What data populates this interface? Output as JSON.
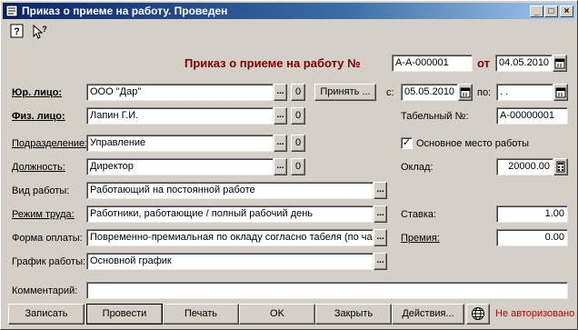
{
  "window": {
    "title": "Приказ о приеме на работу. Проведен",
    "controls": [
      "_",
      "□",
      "×"
    ]
  },
  "toolbar": {
    "help_icon": "?",
    "pointer_icon": "?"
  },
  "header": {
    "title": "Приказ о приеме на работу №",
    "number": "А-А-000001",
    "date_label": "от",
    "date": "04.05.2010"
  },
  "form": {
    "legal_entity": {
      "label": "Юр. лицо:",
      "value": "ООО \"Дар\""
    },
    "person": {
      "label": "Физ. лицо:",
      "value": "Лапин Г.И."
    },
    "department": {
      "label": "Подразделение:",
      "value": "Управление"
    },
    "position": {
      "label": "Должность:",
      "value": "Директор"
    },
    "work_type": {
      "label": "Вид работы:",
      "value": "Работающий на постоянной работе"
    },
    "labor_mode": {
      "label": "Режим труда:",
      "value": "Работники, работающие / полный рабочий день"
    },
    "pay_form": {
      "label": "Форма оплаты:",
      "value": "Повременно-премиальная по окладу согласно табеля (по ча"
    },
    "schedule": {
      "label": "График работы:",
      "value": "Основной график"
    },
    "comment": {
      "label": "Комментарий:",
      "value": ""
    },
    "zero_button": "0",
    "dots_button": "..."
  },
  "right": {
    "accept_button": "Принять ...",
    "from_label": "с:",
    "from_date": "05.05.2010",
    "to_label": "по:",
    "to_date": " .  .",
    "tab_label": "Табельный №:",
    "tab_number": "А-00000001",
    "main_job_label": "Основное место работы",
    "main_job_checked": "✓",
    "salary_label": "Оклад:",
    "salary": "20000.00",
    "rate_label": "Ставка:",
    "rate": "1.00",
    "bonus_label": "Премия:",
    "bonus": "0.00"
  },
  "buttons": {
    "write": "Записать",
    "post": "Провести",
    "print": "Печать",
    "ok": "OK",
    "close": "Закрыть",
    "actions": "Действия...",
    "status": "Не авторизовано"
  },
  "colors": {
    "titlebar_start": "#0a246a",
    "titlebar_end": "#a6caf0",
    "header_title": "#800000",
    "status_text": "#c00000",
    "face": "#d4d0c8"
  }
}
